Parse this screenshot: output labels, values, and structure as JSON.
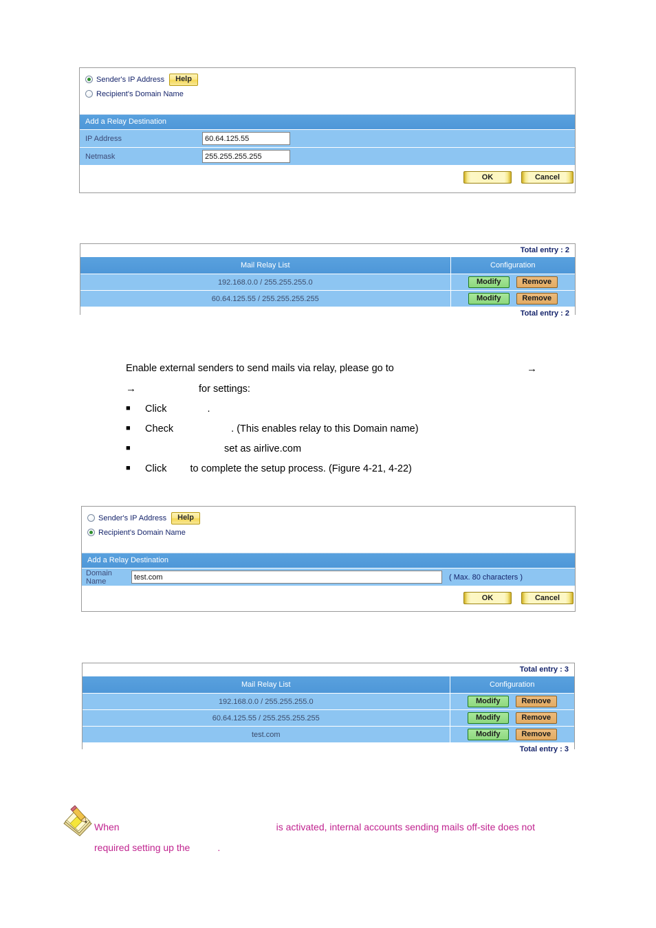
{
  "panel_ip": {
    "radio_sender": "Sender's IP Address",
    "radio_recipient": "Recipient's Domain Name",
    "help_label": "Help",
    "section_title": "Add a Relay Destination",
    "field_ip_label": "IP Address",
    "field_ip_value": "60.64.125.55",
    "field_netmask_label": "Netmask",
    "field_netmask_value": "255.255.255.255",
    "ok_label": "OK",
    "cancel_label": "Cancel"
  },
  "list_top": {
    "total_top": "Total entry : 2",
    "total_bottom": "Total entry : 2",
    "col_list": "Mail Relay List",
    "col_config": "Configuration",
    "modify_label": "Modify",
    "remove_label": "Remove",
    "rows": [
      "192.168.0.0 / 255.255.255.0",
      "60.64.125.55 / 255.255.255.255"
    ]
  },
  "instructions": {
    "intro": "Enable external senders to send mails via relay, please go to",
    "arrow": "→",
    "line2_text": "for settings:",
    "bullets": [
      {
        "verb": "Click",
        "tail": "."
      },
      {
        "verb": "Check",
        "tail": ". (This enables relay to this Domain name)"
      },
      {
        "verb": "",
        "tail": "set as airlive.com"
      },
      {
        "verb": "Click",
        "tail": "to complete the setup process. (Figure 4-21, 4-22)"
      }
    ]
  },
  "panel_domain": {
    "radio_sender": "Sender's IP Address",
    "radio_recipient": "Recipient's Domain Name",
    "help_label": "Help",
    "section_title": "Add a Relay Destination",
    "field_domain_label": "Domain Name",
    "field_domain_value": "test.com",
    "max_chars_hint": "( Max. 80 characters )",
    "ok_label": "OK",
    "cancel_label": "Cancel"
  },
  "list_bottom": {
    "total_top": "Total entry : 3",
    "total_bottom": "Total entry : 3",
    "col_list": "Mail Relay List",
    "col_config": "Configuration",
    "modify_label": "Modify",
    "remove_label": "Remove",
    "rows": [
      "192.168.0.0 / 255.255.255.0",
      "60.64.125.55 / 255.255.255.255",
      "test.com"
    ]
  },
  "note": {
    "line1_a": "When",
    "line1_b": "is  activated,  internal  accounts  sending  mails  off-site  does  not",
    "line2_a": "required setting up the",
    "line2_b": "."
  },
  "colors": {
    "header_blue": "#4e97d8",
    "row_blue": "#8dc5f2",
    "label_navy": "#15246b",
    "note_magenta": "#c0238f",
    "modify_green": "#8dd87d",
    "remove_orange": "#e2ab63",
    "gold": "#fdf6bd"
  }
}
